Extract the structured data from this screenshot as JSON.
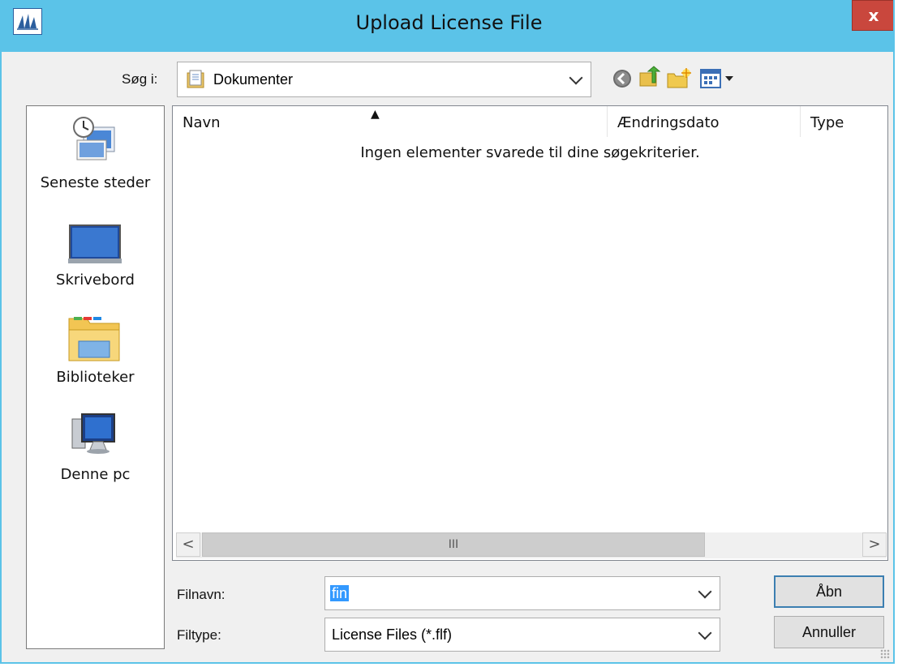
{
  "window": {
    "title": "Upload License File",
    "close_label": "x"
  },
  "lookin": {
    "label": "Søg i:",
    "value": "Dokumenter"
  },
  "toolbar": {
    "icons": [
      "back-icon",
      "up-folder-icon",
      "new-folder-icon",
      "view-menu-icon"
    ]
  },
  "places": [
    {
      "label": "Seneste steder",
      "icon": "recent-places-icon"
    },
    {
      "label": "Skrivebord",
      "icon": "desktop-icon"
    },
    {
      "label": "Biblioteker",
      "icon": "libraries-icon"
    },
    {
      "label": "Denne pc",
      "icon": "this-pc-icon"
    }
  ],
  "filelist": {
    "columns": [
      "Navn",
      "Ændringsdato",
      "Type"
    ],
    "sort_indicator": "▲",
    "empty_message": "Ingen elementer svarede til dine søgekriterier.",
    "scroll_left": "<",
    "scroll_right": ">",
    "thumb_grip": "III"
  },
  "filename": {
    "label": "Filnavn:",
    "value": "fin"
  },
  "filetype": {
    "label": "Filtype:",
    "value": "License Files (*.flf)"
  },
  "buttons": {
    "open": "Åbn",
    "cancel": "Annuller"
  }
}
